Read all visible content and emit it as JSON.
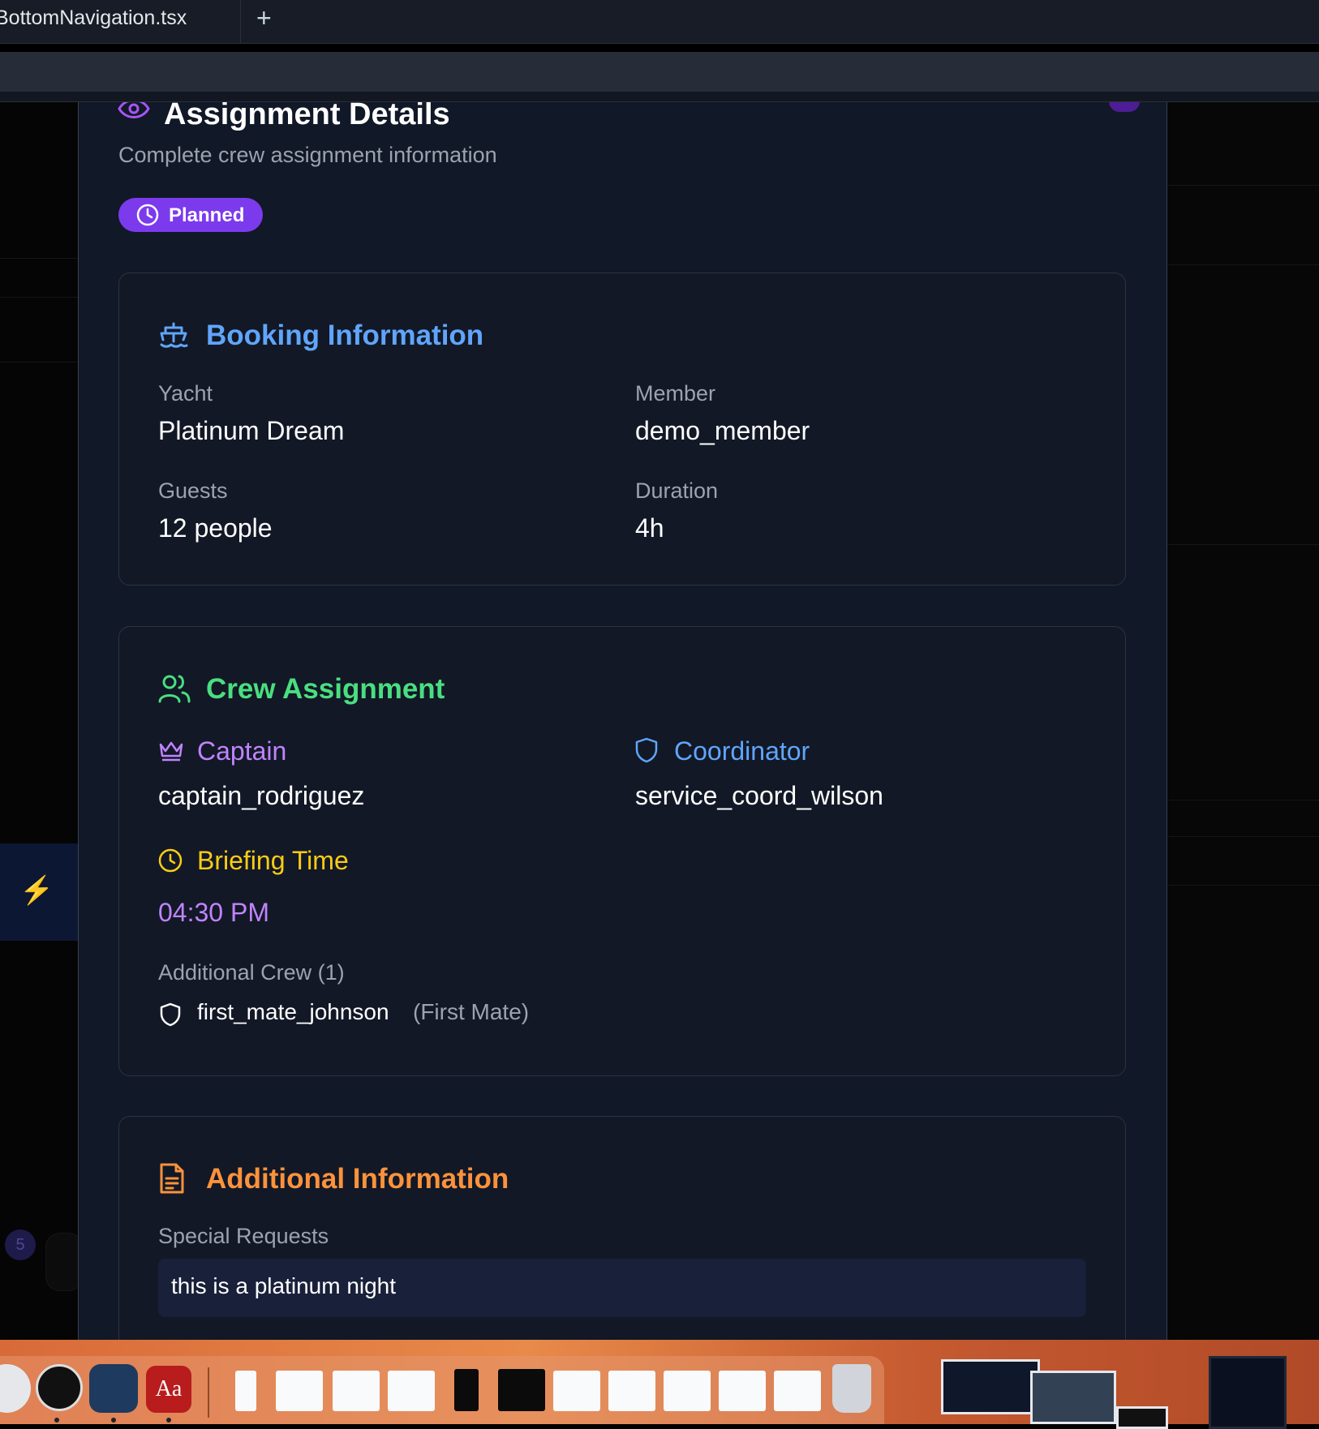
{
  "editor": {
    "tab_label": "BottomNavigation.tsx",
    "add_tab_symbol": "+"
  },
  "background_app": {
    "badge_count": "5"
  },
  "modal": {
    "title": "Assignment Details",
    "subtitle": "Complete crew assignment information",
    "status": "Planned",
    "booking": {
      "title": "Booking Information",
      "yacht_label": "Yacht",
      "yacht_value": "Platinum Dream",
      "member_label": "Member",
      "member_value": "demo_member",
      "guests_label": "Guests",
      "guests_value": "12 people",
      "duration_label": "Duration",
      "duration_value": "4h"
    },
    "crew": {
      "title": "Crew Assignment",
      "captain_label": "Captain",
      "captain_value": "captain_rodriguez",
      "coordinator_label": "Coordinator",
      "coordinator_value": "service_coord_wilson",
      "briefing_label": "Briefing Time",
      "briefing_value": "04:30 PM",
      "additional_label": "Additional Crew (1)",
      "additional_members": [
        {
          "name": "first_mate_johnson",
          "role": "(First Mate)"
        }
      ]
    },
    "additional_info": {
      "title": "Additional Information",
      "special_requests_label": "Special Requests",
      "special_requests_value": "this is a platinum night"
    }
  },
  "dock": {
    "dictionary_label": "Aa"
  },
  "colors": {
    "accent_purple": "#7c3aed",
    "booking_blue": "#60a5fa",
    "crew_green": "#4ade80",
    "captain_purple": "#c084fc",
    "briefing_yellow": "#facc15",
    "info_orange": "#fb923c",
    "modal_bg": "#111827"
  }
}
